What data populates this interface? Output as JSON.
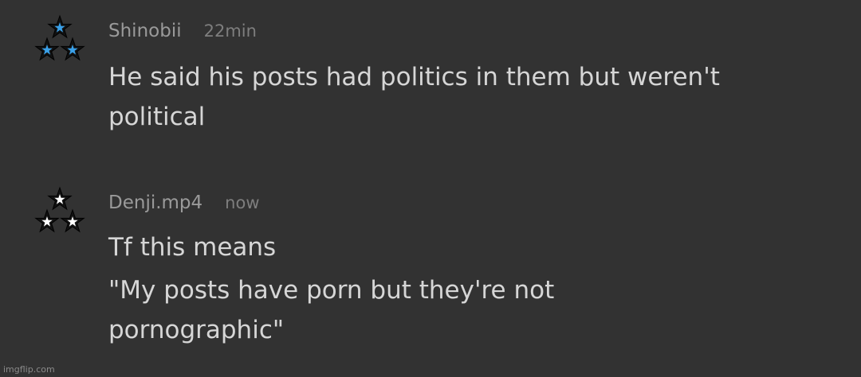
{
  "comments": [
    {
      "username": "Shinobii",
      "time": "22min",
      "lines": [
        "He said his posts had politics in them but weren't",
        "political"
      ],
      "avatar": {
        "icon": "three-star-rank-icon",
        "star_fill": "#3aa0e8"
      }
    },
    {
      "username": "Denji.mp4",
      "time": "now",
      "lines": [
        "Tf this means",
        "\"My posts have porn but they're not",
        "pornographic\""
      ],
      "avatar": {
        "icon": "three-star-rank-icon",
        "star_fill": "#ffffff"
      }
    }
  ],
  "watermark": "imgflip.com",
  "colors": {
    "background": "#323232",
    "username": "#9a9a9a",
    "timestamp": "#7e7e7e",
    "text": "#d6d6d6"
  }
}
